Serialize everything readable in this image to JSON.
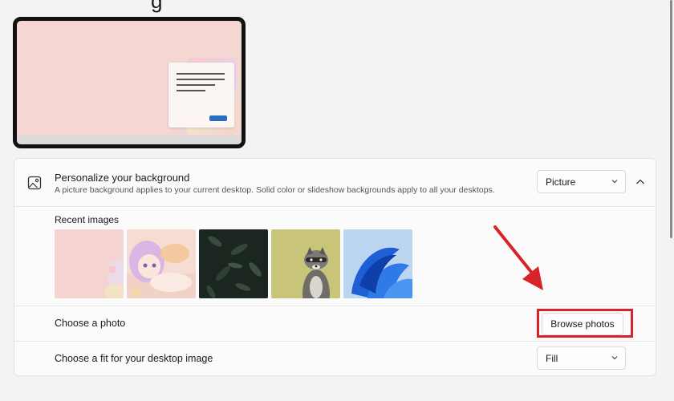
{
  "page": {
    "title_fragment": "g"
  },
  "personalize": {
    "title": "Personalize your background",
    "subtitle": "A picture background applies to your current desktop. Solid color or slideshow backgrounds apply to all your desktops.",
    "icon": "image-icon",
    "background_type": {
      "selected": "Picture",
      "icon": "chevron-down-icon"
    },
    "collapse_icon": "chevron-up-icon"
  },
  "recent": {
    "label": "Recent images",
    "images": [
      {
        "name": "pink-anime-wallpaper"
      },
      {
        "name": "anime-girl-wallpaper"
      },
      {
        "name": "dark-leaves-wallpaper"
      },
      {
        "name": "raccoon-wallpaper"
      },
      {
        "name": "windows-bloom-wallpaper"
      }
    ]
  },
  "choose_photo": {
    "label": "Choose a photo",
    "button": "Browse photos"
  },
  "fit": {
    "label": "Choose a fit for your desktop image",
    "selected": "Fill",
    "icon": "chevron-down-icon"
  },
  "colors": {
    "highlight": "#d9232a",
    "accent": "#2a6cc4"
  }
}
